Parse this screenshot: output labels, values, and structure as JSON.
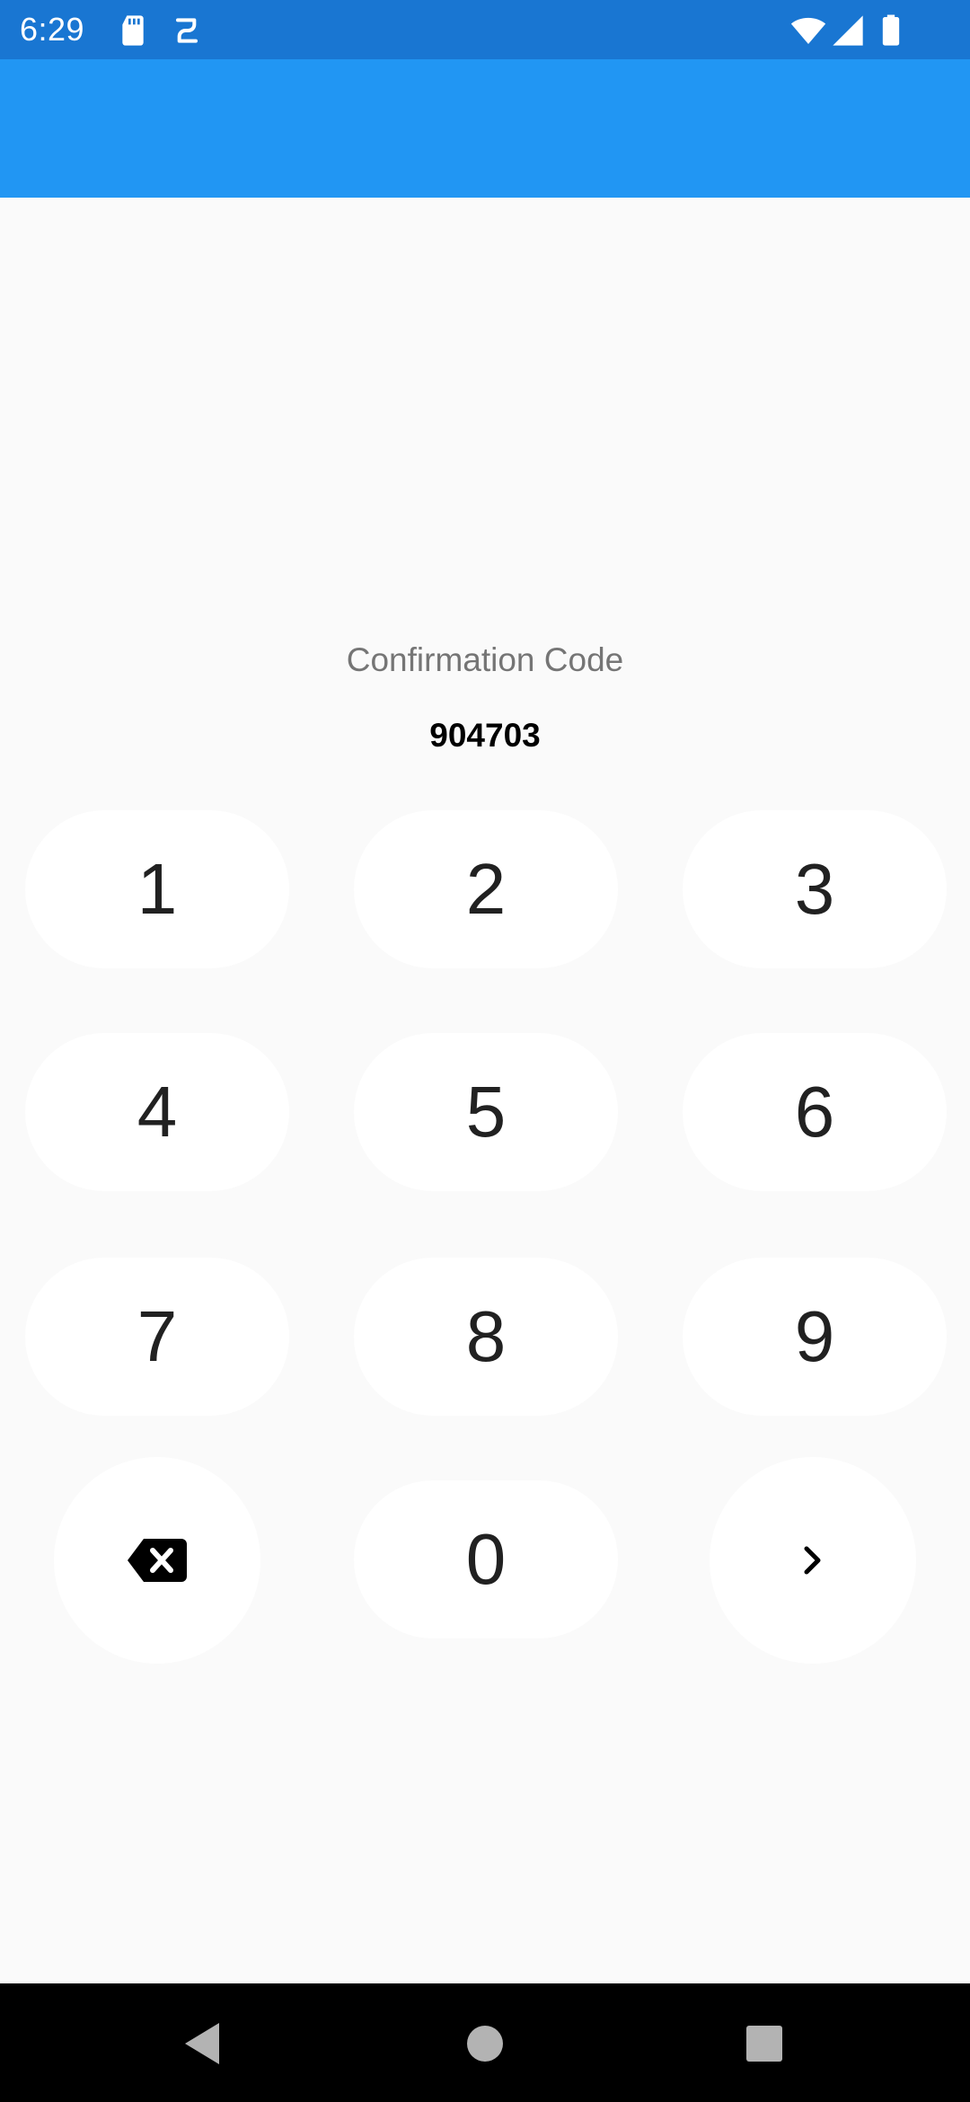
{
  "status_bar": {
    "time": "6:29",
    "icons": [
      "sd-card-icon",
      "sync-icon",
      "wifi-icon",
      "signal-icon",
      "battery-icon"
    ]
  },
  "app_bar": {
    "color": "#2196f3"
  },
  "confirmation": {
    "label": "Confirmation Code",
    "code": "904703"
  },
  "keypad": {
    "keys": [
      "1",
      "2",
      "3",
      "4",
      "5",
      "6",
      "7",
      "8",
      "9",
      "0"
    ],
    "backspace_icon": "backspace-icon",
    "next_icon": "chevron-right-icon"
  },
  "nav_bar": {
    "icons": [
      "back-triangle-icon",
      "home-circle-icon",
      "recents-square-icon"
    ]
  }
}
